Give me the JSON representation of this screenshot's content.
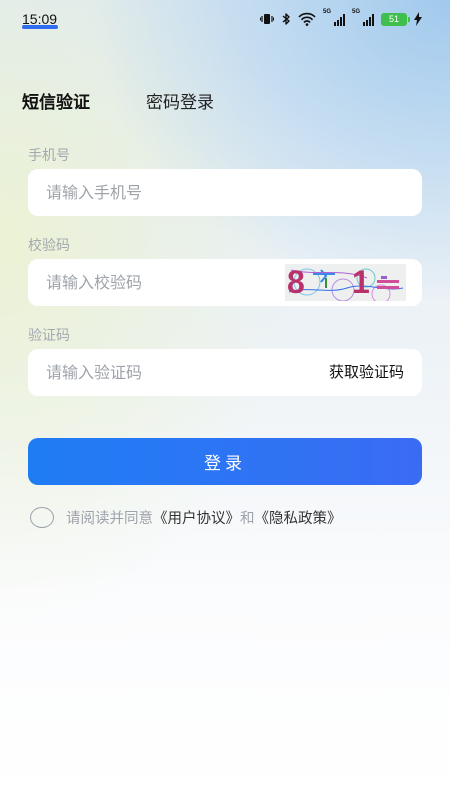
{
  "status_bar": {
    "time": "15:09",
    "network_labels": [
      "5G",
      "5G"
    ],
    "battery": "51",
    "icons": [
      "vibrate-icon",
      "bluetooth-icon",
      "wifi-icon",
      "signal-icon",
      "signal-icon",
      "battery-icon",
      "charging-icon"
    ]
  },
  "tabs": [
    {
      "label": "短信验证",
      "active": true
    },
    {
      "label": "密码登录",
      "active": false
    }
  ],
  "phone": {
    "label": "手机号",
    "placeholder": "请输入手机号"
  },
  "captcha": {
    "label": "校验码",
    "placeholder": "请输入校验码",
    "image_text": [
      "8",
      "1"
    ]
  },
  "sms": {
    "label": "验证码",
    "placeholder": "请输入验证码",
    "get_code": "获取验证码"
  },
  "login_button": "登录",
  "agreement": {
    "prefix": "请阅读并同意",
    "user_agreement": "《用户协议》",
    "and": "和",
    "privacy_policy": "《隐私政策》"
  },
  "colors": {
    "accent": "#2f6cf0",
    "button_start": "#1f7df4",
    "button_end": "#3a6cf3",
    "battery": "#3fbf4d"
  }
}
